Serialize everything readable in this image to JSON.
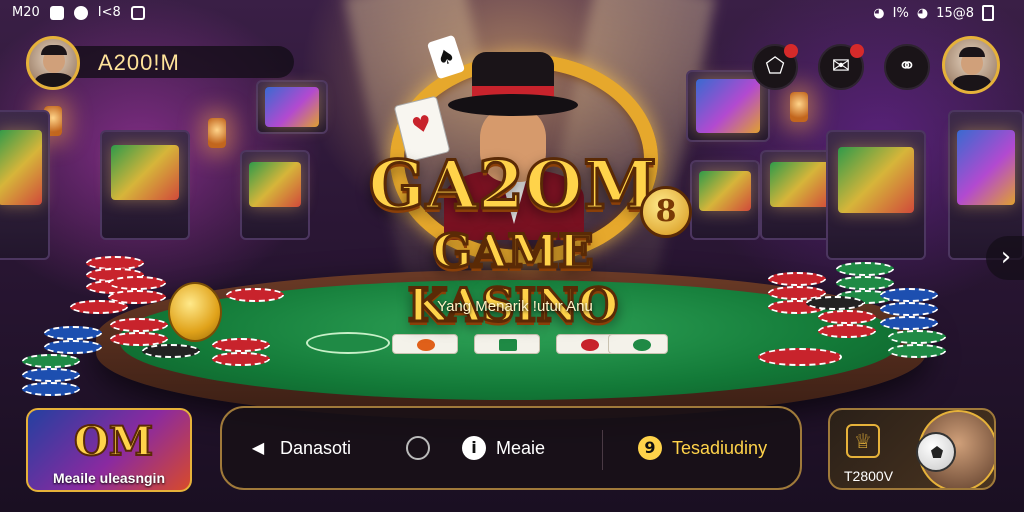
{
  "status_bar": {
    "left_text": "M20",
    "app_label": "I<8",
    "battery_text": "I%",
    "right_text": "15@8"
  },
  "header": {
    "username": "A200!M"
  },
  "hero": {
    "logo_main": "GA2OM",
    "logo_badge": "8",
    "logo_sub": "GAME KASINO",
    "tagline": "Yang Menarik !utur Anu"
  },
  "bottom_nav": {
    "items": [
      {
        "label": "Danasoti",
        "icon": "arrow-left-icon"
      },
      {
        "label": "",
        "icon": "location-icon"
      },
      {
        "label": "Meaie",
        "icon": "info-icon"
      },
      {
        "label": "Tesadiudiny",
        "icon": "coin-icon"
      }
    ]
  },
  "promos": {
    "left_label": "Meaile uleasngin",
    "left_logo": "OM",
    "right_label": "T2800V"
  },
  "colors": {
    "gold": "#ffd34a",
    "felt": "#137a38",
    "accent_red": "#c8232c"
  }
}
